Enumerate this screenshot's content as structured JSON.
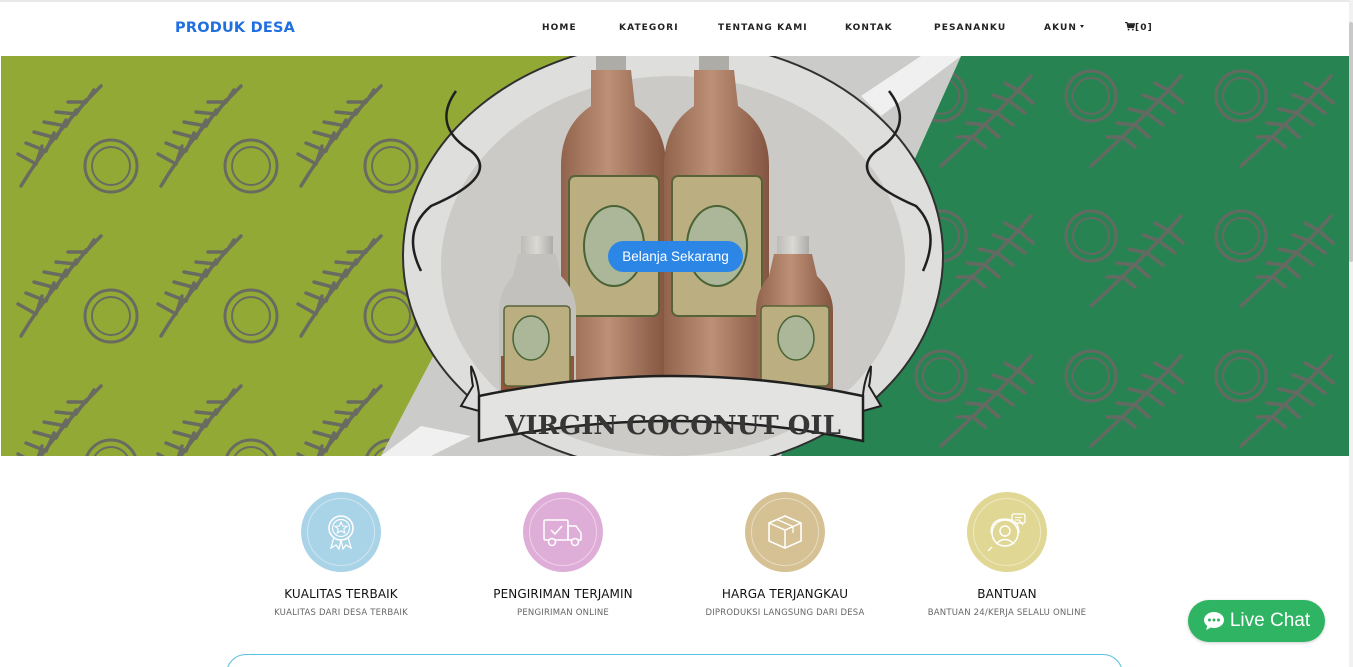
{
  "navbar": {
    "brand": "PRODUK DESA",
    "items": [
      {
        "label": "HOME"
      },
      {
        "label": "KATEGORI"
      },
      {
        "label": "TENTANG KAMI"
      },
      {
        "label": "KONTAK"
      },
      {
        "label": "PESANANKU"
      },
      {
        "label": "AKUN"
      }
    ],
    "cart_count": "[0]",
    "account_icon": "caret-down-icon",
    "cart_icon": "cart-icon"
  },
  "hero": {
    "product_banner": "VIRGIN COCONUT OIL",
    "bottle_label": "VIRGIN COCONUT OIL",
    "cta_label": "Belanja Sekarang",
    "colors": {
      "left": "#9db43a",
      "right": "#2b8c58",
      "cta": "#2b86e6"
    }
  },
  "features": [
    {
      "title": "KUALITAS TERBAIK",
      "subtitle": "KUALITAS DARI DESA TERBAIK",
      "icon": "badge-star-icon",
      "color": "#a9d3e6"
    },
    {
      "title": "PENGIRIMAN TERJAMIN",
      "subtitle": "PENGIRIMAN ONLINE",
      "icon": "delivery-truck-icon",
      "color": "#dfaed8"
    },
    {
      "title": "HARGA TERJANGKAU",
      "subtitle": "DIPRODUKSI LANGSUNG DARI DESA",
      "icon": "package-box-icon",
      "color": "#d5c193"
    },
    {
      "title": "BANTUAN",
      "subtitle": "BANTUAN 24/KERJA SELALU ONLINE",
      "icon": "support-agent-icon",
      "color": "#dfd793"
    }
  ],
  "live_chat": {
    "label": "Live Chat",
    "icon": "chat-bubble-icon",
    "color": "#2fb463"
  }
}
